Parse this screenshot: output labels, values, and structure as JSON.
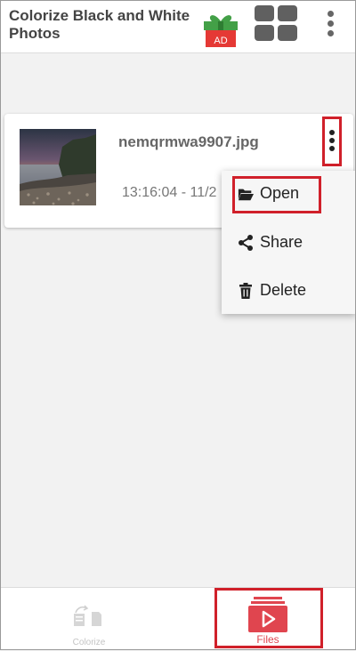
{
  "header": {
    "title": "Colorize Black and White Photos",
    "ad_badge": "AD"
  },
  "file_card": {
    "file_name": "nemqrmwa9907.jpg",
    "timestamp": "13:16:04 - 11/2"
  },
  "context_menu": {
    "items": [
      {
        "label": "Open",
        "icon": "folder-open-icon"
      },
      {
        "label": "Share",
        "icon": "share-icon"
      },
      {
        "label": "Delete",
        "icon": "trash-icon"
      }
    ]
  },
  "bottom_nav": {
    "colorize_label": "Colorize",
    "files_label": "Files"
  },
  "colors": {
    "accent": "#e0454f",
    "highlight": "#d0202a",
    "gift_red": "#e53935",
    "gift_green": "#43a047"
  }
}
